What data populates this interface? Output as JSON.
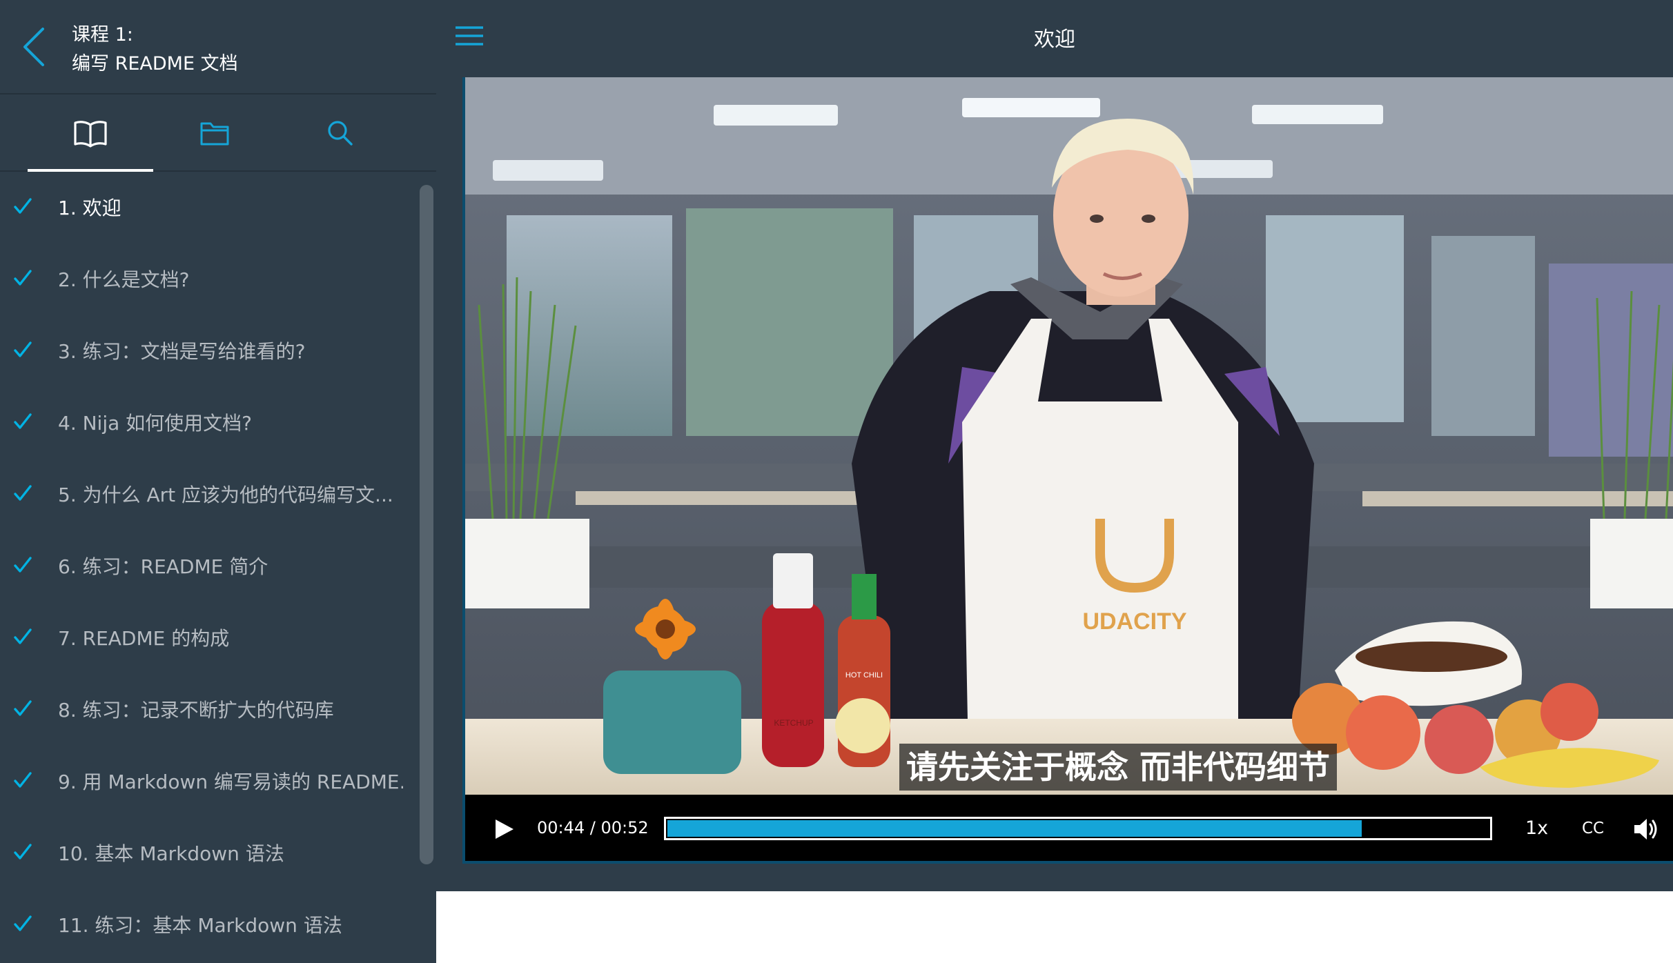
{
  "course": {
    "title_line1": "课程 1:",
    "title_line2": "编写 README 文档"
  },
  "tabs": [
    {
      "name": "lessons",
      "icon": "book-icon",
      "active": true
    },
    {
      "name": "resources",
      "icon": "folder-icon",
      "active": false
    },
    {
      "name": "search",
      "icon": "search-icon",
      "active": false
    }
  ],
  "lessons": [
    {
      "label": "1. 欢迎",
      "completed": true,
      "current": true
    },
    {
      "label": "2. 什么是文档?",
      "completed": true
    },
    {
      "label": "3. 练习：文档是写给谁看的?",
      "completed": true
    },
    {
      "label": "4. Nija 如何使用文档?",
      "completed": true
    },
    {
      "label": "5. 为什么 Art 应该为他的代码编写文...",
      "completed": true
    },
    {
      "label": "6. 练习：README 简介",
      "completed": true
    },
    {
      "label": "7. README 的构成",
      "completed": true
    },
    {
      "label": "8. 练习：记录不断扩大的代码库",
      "completed": true
    },
    {
      "label": "9. 用 Markdown 编写易读的 README...",
      "completed": true
    },
    {
      "label": "10. 基本 Markdown 语法",
      "completed": true
    },
    {
      "label": "11. 练习：基本 Markdown 语法",
      "completed": true
    }
  ],
  "header": {
    "title": "欢迎",
    "menu_icon": "hamburger-menu-icon"
  },
  "video": {
    "subtitle": "请先关注于概念 而非代码细节",
    "current_time": "00:44",
    "duration": "00:52",
    "time_display": "00:44 / 00:52",
    "progress": 0.845,
    "speed": "1x",
    "cc_label": "CC",
    "apron_logo_text": "UDACITY",
    "ketchup_label": "KETCHUP",
    "sauce_label": "HOT CHILI"
  },
  "colors": {
    "sidebar_bg": "#2e3d49",
    "accent": "#15a5d8",
    "check": "#02b3e4",
    "text_muted": "#b6bcc2"
  }
}
